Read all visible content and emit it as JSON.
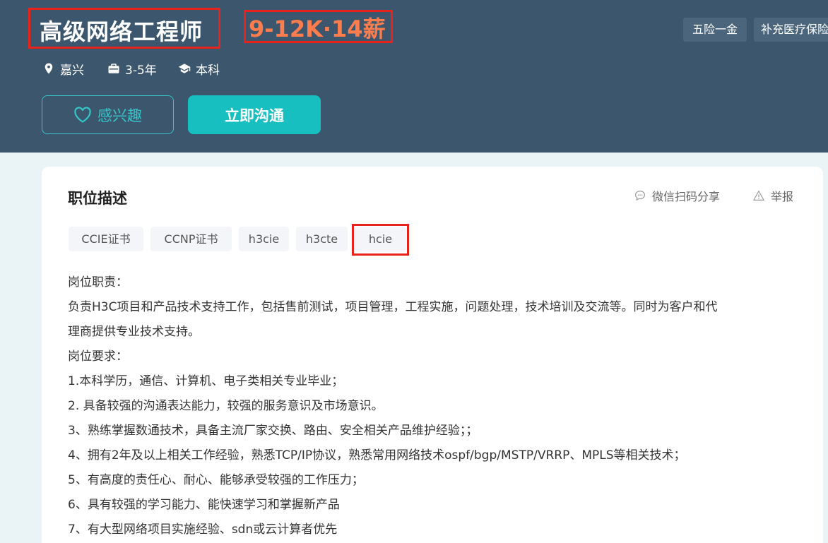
{
  "job": {
    "title": "高级网络工程师",
    "salary": "9-12K·14薪",
    "benefits": [
      "五险一金",
      "补充医疗保险"
    ],
    "city": "嘉兴",
    "experience": "3-5年",
    "education": "本科"
  },
  "buttons": {
    "interest_label": "感兴趣",
    "chat_label": "立即沟通"
  },
  "section": {
    "title": "职位描述",
    "share_label": "微信扫码分享",
    "report_label": "举报"
  },
  "tags": [
    "CCIE证书",
    "CCNP证书",
    "h3cie",
    "h3cte",
    "hcie"
  ],
  "description": [
    "岗位职责：",
    "负责H3C项目和产品技术支持工作，包括售前测试，项目管理，工程实施，问题处理，技术培训及交流等。同时为客户和代",
    "理商提供专业技术支持。",
    "岗位要求：",
    "1.本科学历，通信、计算机、电子类相关专业毕业；",
    "2. 具备较强的沟通表达能力，较强的服务意识及市场意识。",
    "3、熟练掌握数通技术，具备主流厂家交换、路由、安全相关产品维护经验；；",
    "4、拥有2年及以上相关工作经验，熟悉TCP/IP协议，熟悉常用网络技术ospf/bgp/MSTP/VRRP、MPLS等相关技术；",
    "5、有高度的责任心、耐心、能够承受较强的工作压力；",
    "6、具有较强的学习能力、能快速学习和掌握新产品",
    "7、有大型网络项目实施经验、sdn或云计算者优先"
  ],
  "colors": {
    "header_bg": "#3b566d",
    "salary": "#ff7d4d",
    "accent": "#17bfc0",
    "highlight_box": "#e8231b"
  }
}
